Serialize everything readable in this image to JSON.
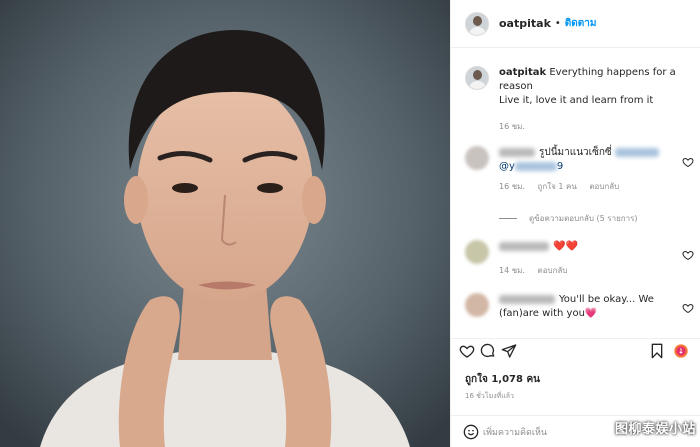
{
  "photo": {
    "alt": ""
  },
  "header": {
    "username": "oatpitak",
    "separator": "•",
    "follow_label": "ติดตาม"
  },
  "caption": {
    "username": "oatpitak",
    "text_line1": "Everything happens for a reason",
    "text_line2": "Live it, love it and learn from it",
    "time": "16 ชม."
  },
  "comments": [
    {
      "text": "รูปนี้มาแนวเซ็กซี่",
      "mention_prefix": "@y",
      "mention_suffix": "9",
      "time": "16 ชม.",
      "likes": "ถูกใจ 1 คน",
      "reply_label": "ตอบกลับ",
      "view_replies": "ดูข้อความตอบกลับ (5 รายการ)"
    },
    {
      "text": "❤️❤️",
      "time": "14 ชม.",
      "reply_label": "ตอบกลับ"
    },
    {
      "text": "You'll be okay... We (fan)are with you💗"
    }
  ],
  "icons": [
    "heart-icon",
    "comment-icon",
    "share-icon",
    "bookmark-icon",
    "emoji-icon",
    "bonus-badge-icon"
  ],
  "likes": "ถูกใจ 1,078 คน",
  "post_time": "16 ชั่วโมงที่แล้ว",
  "add_comment": {
    "placeholder": "เพิ่มความคิดเห็น"
  },
  "watermark": "图柳泰娱小站",
  "colors": {
    "follow": "#0095f6",
    "heart_red": "#ed4956",
    "muted": "#8e8e8e",
    "border": "#efefef"
  }
}
